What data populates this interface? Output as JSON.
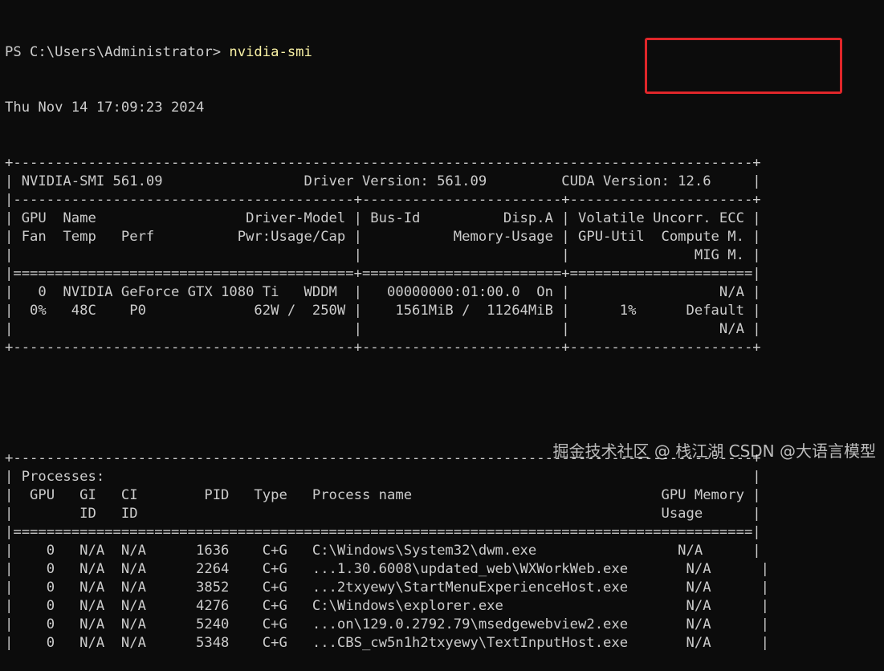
{
  "prompt": {
    "path": "PS C:\\Users\\Administrator> ",
    "command": "nvidia-smi"
  },
  "timestamp": "Thu Nov 14 17:09:23 2024",
  "gpu_table": [
    "+-----------------------------------------------------------------------------------------+",
    "| NVIDIA-SMI 561.09                 Driver Version: 561.09         CUDA Version: 12.6     |",
    "|-----------------------------------------+------------------------+----------------------+",
    "| GPU  Name                  Driver-Model | Bus-Id          Disp.A | Volatile Uncorr. ECC |",
    "| Fan  Temp   Perf          Pwr:Usage/Cap |           Memory-Usage | GPU-Util  Compute M. |",
    "|                                         |                        |               MIG M. |",
    "|=========================================+========================+======================|",
    "|   0  NVIDIA GeForce GTX 1080 Ti   WDDM  |   00000000:01:00.0  On |                  N/A |",
    "|  0%   48C    P0             62W /  250W |    1561MiB /  11264MiB |      1%      Default |",
    "|                                         |                        |                  N/A |",
    "+-----------------------------------------+------------------------+----------------------+"
  ],
  "process_table": [
    "+-----------------------------------------------------------------------------------------+",
    "| Processes:                                                                              |",
    "|  GPU   GI   CI        PID   Type   Process name                              GPU Memory |",
    "|        ID   ID                                                               Usage      |",
    "|=========================================================================================|",
    "|    0   N/A  N/A      1636    C+G   C:\\Windows\\System32\\dwm.exe                 N/A      |",
    "|    0   N/A  N/A      2264    C+G   ...1.30.6008\\updated_web\\WXWorkWeb.exe       N/A      |",
    "|    0   N/A  N/A      3852    C+G   ...2txyewy\\StartMenuExperienceHost.exe       N/A      |",
    "|    0   N/A  N/A      4276    C+G   C:\\Windows\\explorer.exe                      N/A      |",
    "|    0   N/A  N/A      5240    C+G   ...on\\129.0.2792.79\\msedgewebview2.exe       N/A      |",
    "|    0   N/A  N/A      5348    C+G   ...CBS_cw5n1h2txyewy\\TextInputHost.exe       N/A      |"
  ],
  "watermark": "掘金技术社区 @ 栈江湖  CSDN @大语言模型",
  "colors": {
    "background": "#0c0c0c",
    "text": "#cccccc",
    "command": "#f9f1a5",
    "highlight_border": "#e0262a"
  }
}
